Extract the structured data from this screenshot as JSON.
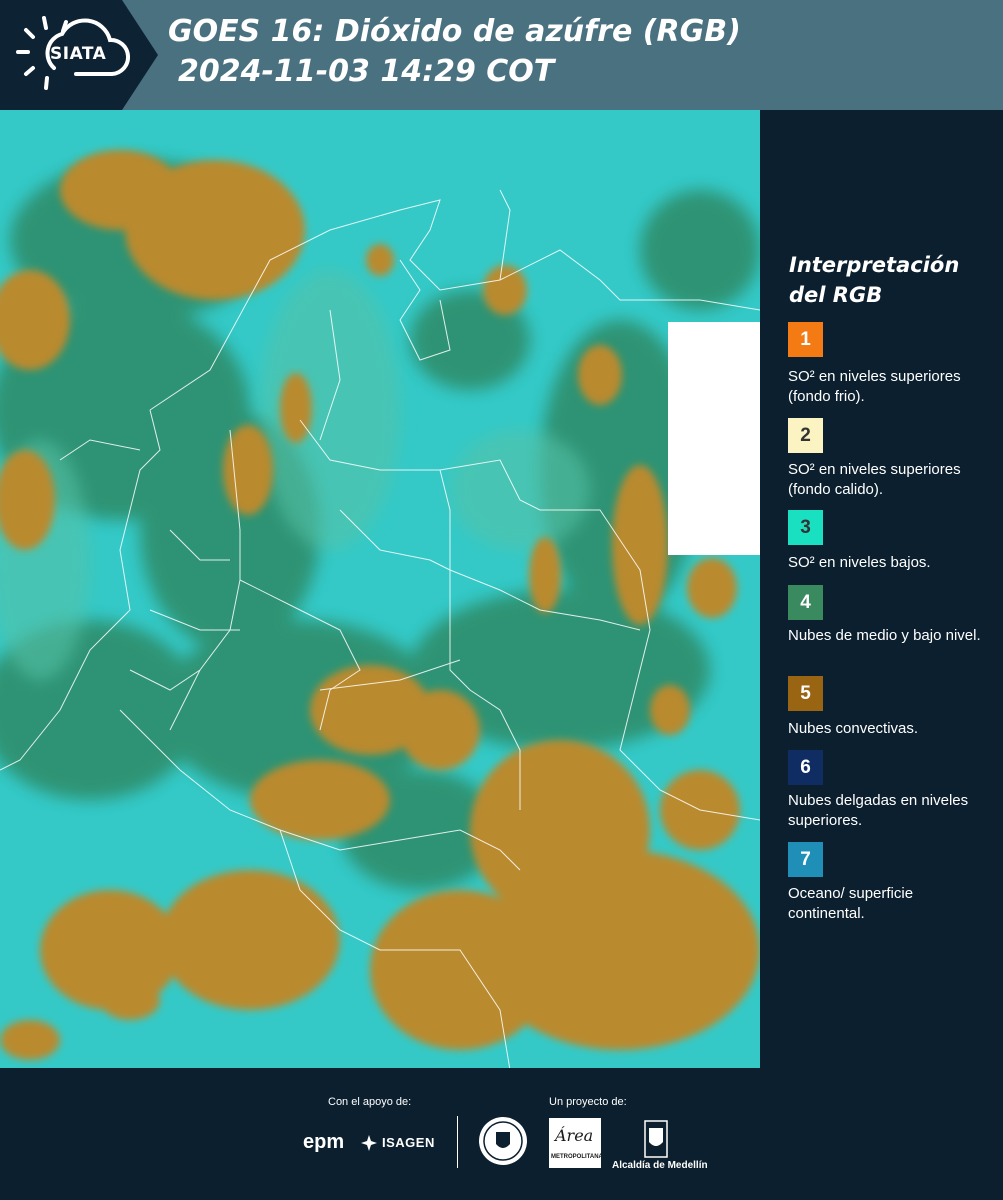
{
  "header": {
    "logo_text": "SIATA",
    "title_line1": "GOES 16: Dióxido de azúfre (RGB)",
    "title_line2": "2024-11-03 14:29 COT"
  },
  "legend": {
    "title": "Interpretación del RGB",
    "items": [
      {
        "number": "1",
        "color": "#f47a14",
        "text_color": "#ffffff",
        "label": "SO² en niveles superiores (fondo frio)."
      },
      {
        "number": "2",
        "color": "#fbf3c1",
        "text_color": "#333333",
        "label": "SO² en niveles superiores (fondo calido)."
      },
      {
        "number": "3",
        "color": "#19e0c0",
        "text_color": "#333333",
        "label": "SO² en niveles bajos."
      },
      {
        "number": "4",
        "color": "#3a8a60",
        "text_color": "#ffffff",
        "label": "Nubes de medio y bajo nivel."
      },
      {
        "number": "5",
        "color": "#9a6512",
        "text_color": "#ffffff",
        "label": "Nubes convectivas."
      },
      {
        "number": "6",
        "color": "#0f2c63",
        "text_color": "#ffffff",
        "label": "Nubes delgadas en niveles superiores."
      },
      {
        "number": "7",
        "color": "#1f8fb8",
        "text_color": "#ffffff",
        "label": "Oceano/ superficie continental."
      }
    ]
  },
  "footer": {
    "support_label": "Con el apoyo de:",
    "project_label": "Un proyecto de:",
    "sponsor1": "epm",
    "sponsor2": "ISAGEN",
    "area_logo_text": "Área",
    "area_sub": "METROPOLITANA",
    "alcaldia": "Alcaldía de Medellín"
  }
}
